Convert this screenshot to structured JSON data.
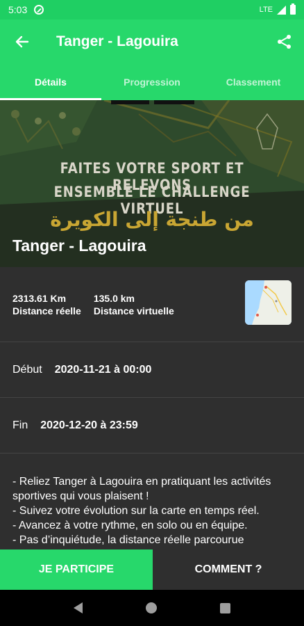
{
  "status_bar": {
    "time": "5:03",
    "network": "LTE"
  },
  "app_bar": {
    "title": "Tanger - Lagouira"
  },
  "tabs": [
    {
      "label": "Détails",
      "active": true
    },
    {
      "label": "Progression",
      "active": false
    },
    {
      "label": "Classement",
      "active": false
    }
  ],
  "hero": {
    "line1": "FAITES VOTRE SPORT ET RELEVONS",
    "line2": "ENSEMBLE LE CHALLENGE VIRTUEL",
    "arabic": "من طنجة إلى الكويرة",
    "title": "Tanger - Lagouira"
  },
  "distance": {
    "real_value": "2313.61 Km",
    "real_label": "Distance réelle",
    "virtual_value": "135.0 km",
    "virtual_label": "Distance virtuelle"
  },
  "debut": {
    "label": "Début",
    "value": "2020-11-21 à 00:00"
  },
  "fin": {
    "label": "Fin",
    "value": "2020-12-20 à 23:59"
  },
  "description": [
    "- Reliez Tanger à Lagouira en pratiquant les activités sportives qui vous plaisent !",
    "- Suivez votre évolution sur la carte en temps réel.",
    "- Avancez à votre rythme, en solo ou en équipe.",
    "- Pas d’inquiétude, la distance réelle parcourue"
  ],
  "actions": {
    "participate": "JE PARTICIPE",
    "how": "COMMENT ?"
  },
  "colors": {
    "primary": "#27d86b",
    "status_bar": "#1fcf63",
    "background": "#2f2f2f",
    "gold": "#c9a633"
  }
}
